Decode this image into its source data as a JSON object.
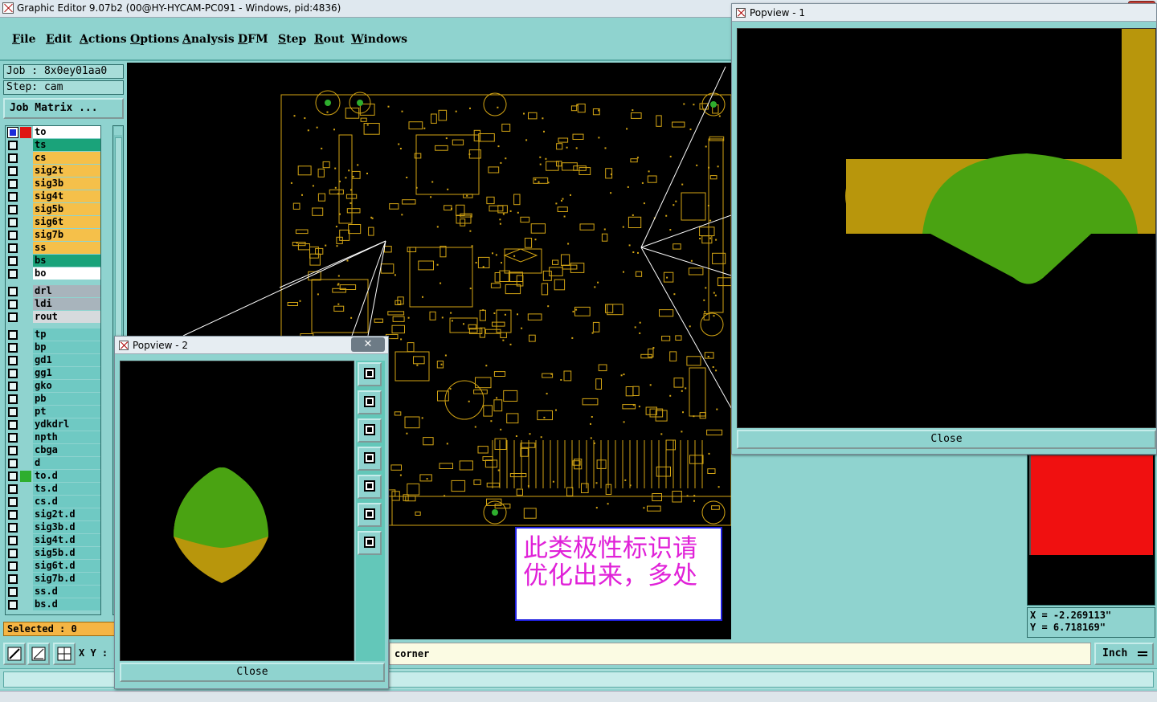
{
  "window": {
    "title": "Graphic Editor 9.07b2 (00@HY-HYCAM-PC091 - Windows, pid:4836)"
  },
  "menu": [
    {
      "label": "File",
      "key": "F",
      "rest": "ile"
    },
    {
      "label": "Edit",
      "key": "E",
      "rest": "dit"
    },
    {
      "label": "Actions",
      "key": "A",
      "rest": "ctions"
    },
    {
      "label": "Options",
      "key": "O",
      "rest": "ptions"
    },
    {
      "label": "Analysis",
      "key": "A",
      "rest": "nalysis"
    },
    {
      "label": "DFM",
      "key": "D",
      "rest": "FM"
    },
    {
      "label": "Step",
      "key": "S",
      "rest": "tep"
    },
    {
      "label": "Rout",
      "key": "R",
      "rest": "out"
    },
    {
      "label": "Windows",
      "key": "W",
      "rest": "indows"
    }
  ],
  "job": {
    "job_label": "Job : 8x0ey01aa0",
    "step_label": "Step: cam",
    "matrix_button": "Job Matrix ..."
  },
  "layers": [
    {
      "name": "to",
      "color": "#ffffff",
      "swatch": "#e01414",
      "active": true
    },
    {
      "name": "ts",
      "color": "#1aa37a",
      "swatch": "",
      "active": false
    },
    {
      "name": "cs",
      "color": "#f5c04a",
      "swatch": "",
      "active": false
    },
    {
      "name": "sig2t",
      "color": "#f5c04a",
      "swatch": "",
      "active": false
    },
    {
      "name": "sig3b",
      "color": "#f5c04a",
      "swatch": "",
      "active": false
    },
    {
      "name": "sig4t",
      "color": "#f5c04a",
      "swatch": "",
      "active": false
    },
    {
      "name": "sig5b",
      "color": "#f5c04a",
      "swatch": "",
      "active": false
    },
    {
      "name": "sig6t",
      "color": "#f5c04a",
      "swatch": "",
      "active": false
    },
    {
      "name": "sig7b",
      "color": "#f5c04a",
      "swatch": "",
      "active": false
    },
    {
      "name": "ss",
      "color": "#f5c04a",
      "swatch": "",
      "active": false
    },
    {
      "name": "bs",
      "color": "#1aa37a",
      "swatch": "",
      "active": false
    },
    {
      "name": "bo",
      "color": "#ffffff",
      "swatch": "",
      "active": false
    },
    {
      "name": "drl",
      "color": "#a8b4bc",
      "swatch": "",
      "active": false,
      "gap": true
    },
    {
      "name": "ldi",
      "color": "#a8b4bc",
      "swatch": "",
      "active": false
    },
    {
      "name": "rout",
      "color": "#d6dadd",
      "swatch": "",
      "active": false
    },
    {
      "name": "tp",
      "color": "#6fc9c3",
      "swatch": "",
      "active": false,
      "gap": true
    },
    {
      "name": "bp",
      "color": "#6fc9c3",
      "swatch": "",
      "active": false
    },
    {
      "name": "gd1",
      "color": "#6fc9c3",
      "swatch": "",
      "active": false
    },
    {
      "name": "gg1",
      "color": "#6fc9c3",
      "swatch": "",
      "active": false
    },
    {
      "name": "gko",
      "color": "#6fc9c3",
      "swatch": "",
      "active": false
    },
    {
      "name": "pb",
      "color": "#6fc9c3",
      "swatch": "",
      "active": false
    },
    {
      "name": "pt",
      "color": "#6fc9c3",
      "swatch": "",
      "active": false
    },
    {
      "name": "ydkdrl",
      "color": "#6fc9c3",
      "swatch": "",
      "active": false
    },
    {
      "name": "npth",
      "color": "#6fc9c3",
      "swatch": "",
      "active": false
    },
    {
      "name": "cbga",
      "color": "#6fc9c3",
      "swatch": "",
      "active": false
    },
    {
      "name": "d",
      "color": "#6fc9c3",
      "swatch": "",
      "active": false
    },
    {
      "name": "to.d",
      "color": "#6fc9c3",
      "swatch": "#2eae2e",
      "active": false
    },
    {
      "name": "ts.d",
      "color": "#6fc9c3",
      "swatch": "",
      "active": false
    },
    {
      "name": "cs.d",
      "color": "#6fc9c3",
      "swatch": "",
      "active": false
    },
    {
      "name": "sig2t.d",
      "color": "#6fc9c3",
      "swatch": "",
      "active": false
    },
    {
      "name": "sig3b.d",
      "color": "#6fc9c3",
      "swatch": "",
      "active": false
    },
    {
      "name": "sig4t.d",
      "color": "#6fc9c3",
      "swatch": "",
      "active": false
    },
    {
      "name": "sig5b.d",
      "color": "#6fc9c3",
      "swatch": "",
      "active": false
    },
    {
      "name": "sig6t.d",
      "color": "#6fc9c3",
      "swatch": "",
      "active": false
    },
    {
      "name": "sig7b.d",
      "color": "#6fc9c3",
      "swatch": "",
      "active": false
    },
    {
      "name": "ss.d",
      "color": "#6fc9c3",
      "swatch": "",
      "active": false
    },
    {
      "name": "bs.d",
      "color": "#6fc9c3",
      "swatch": "",
      "active": false
    }
  ],
  "selected_label": "Selected : 0",
  "bottom": {
    "xy_label": "X Y :",
    "command_text": "corner",
    "unit": "Inch"
  },
  "coords": {
    "x": "X = -2.269113\"",
    "y": "Y = 6.718169\""
  },
  "popview1": {
    "title": "Popview - 1",
    "close_label": "Close"
  },
  "popview2": {
    "title": "Popview - 2",
    "close_label": "Close",
    "x_label": "✕"
  },
  "annotation": {
    "line1": "此类极性标识请",
    "line2": "优化出来，多处"
  },
  "colors": {
    "board_line": "#d4a514",
    "pad_copper": "#b8960c",
    "polarity_mark": "#4aa312",
    "annotation_text": "#e021d8"
  }
}
